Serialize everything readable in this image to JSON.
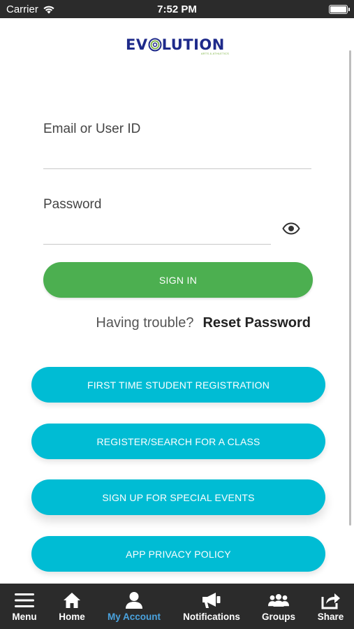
{
  "status_bar": {
    "carrier": "Carrier",
    "time": "7:52 PM"
  },
  "logo": {
    "text_before": "EV",
    "text_after": "LUTION",
    "subtitle": "ARTS & ATHLETICS",
    "colors": {
      "blue": "#1e2a8a",
      "green": "#7cb342"
    }
  },
  "form": {
    "email_label": "Email or User ID",
    "email_value": "",
    "password_label": "Password",
    "password_value": "",
    "show_password_icon": "eye-icon",
    "signin_label": "SIGN IN",
    "trouble_text": "Having trouble?",
    "reset_link": "Reset Password"
  },
  "actions": [
    {
      "label": "FIRST TIME STUDENT REGISTRATION"
    },
    {
      "label": "REGISTER/SEARCH FOR A CLASS"
    },
    {
      "label": "SIGN UP FOR SPECIAL EVENTS"
    },
    {
      "label": "APP PRIVACY POLICY"
    }
  ],
  "tab_bar": {
    "active": "My Account",
    "tabs": [
      {
        "label": "Menu",
        "icon": "menu-icon"
      },
      {
        "label": "Home",
        "icon": "home-icon"
      },
      {
        "label": "My Account",
        "icon": "account-icon"
      },
      {
        "label": "Notifications",
        "icon": "megaphone-icon"
      },
      {
        "label": "Groups",
        "icon": "groups-icon"
      },
      {
        "label": "Share",
        "icon": "share-icon"
      }
    ]
  },
  "colors": {
    "signin": "#4caf50",
    "action": "#00bcd4",
    "bar": "#2b2b2b",
    "active_tab": "#4aa3df"
  }
}
